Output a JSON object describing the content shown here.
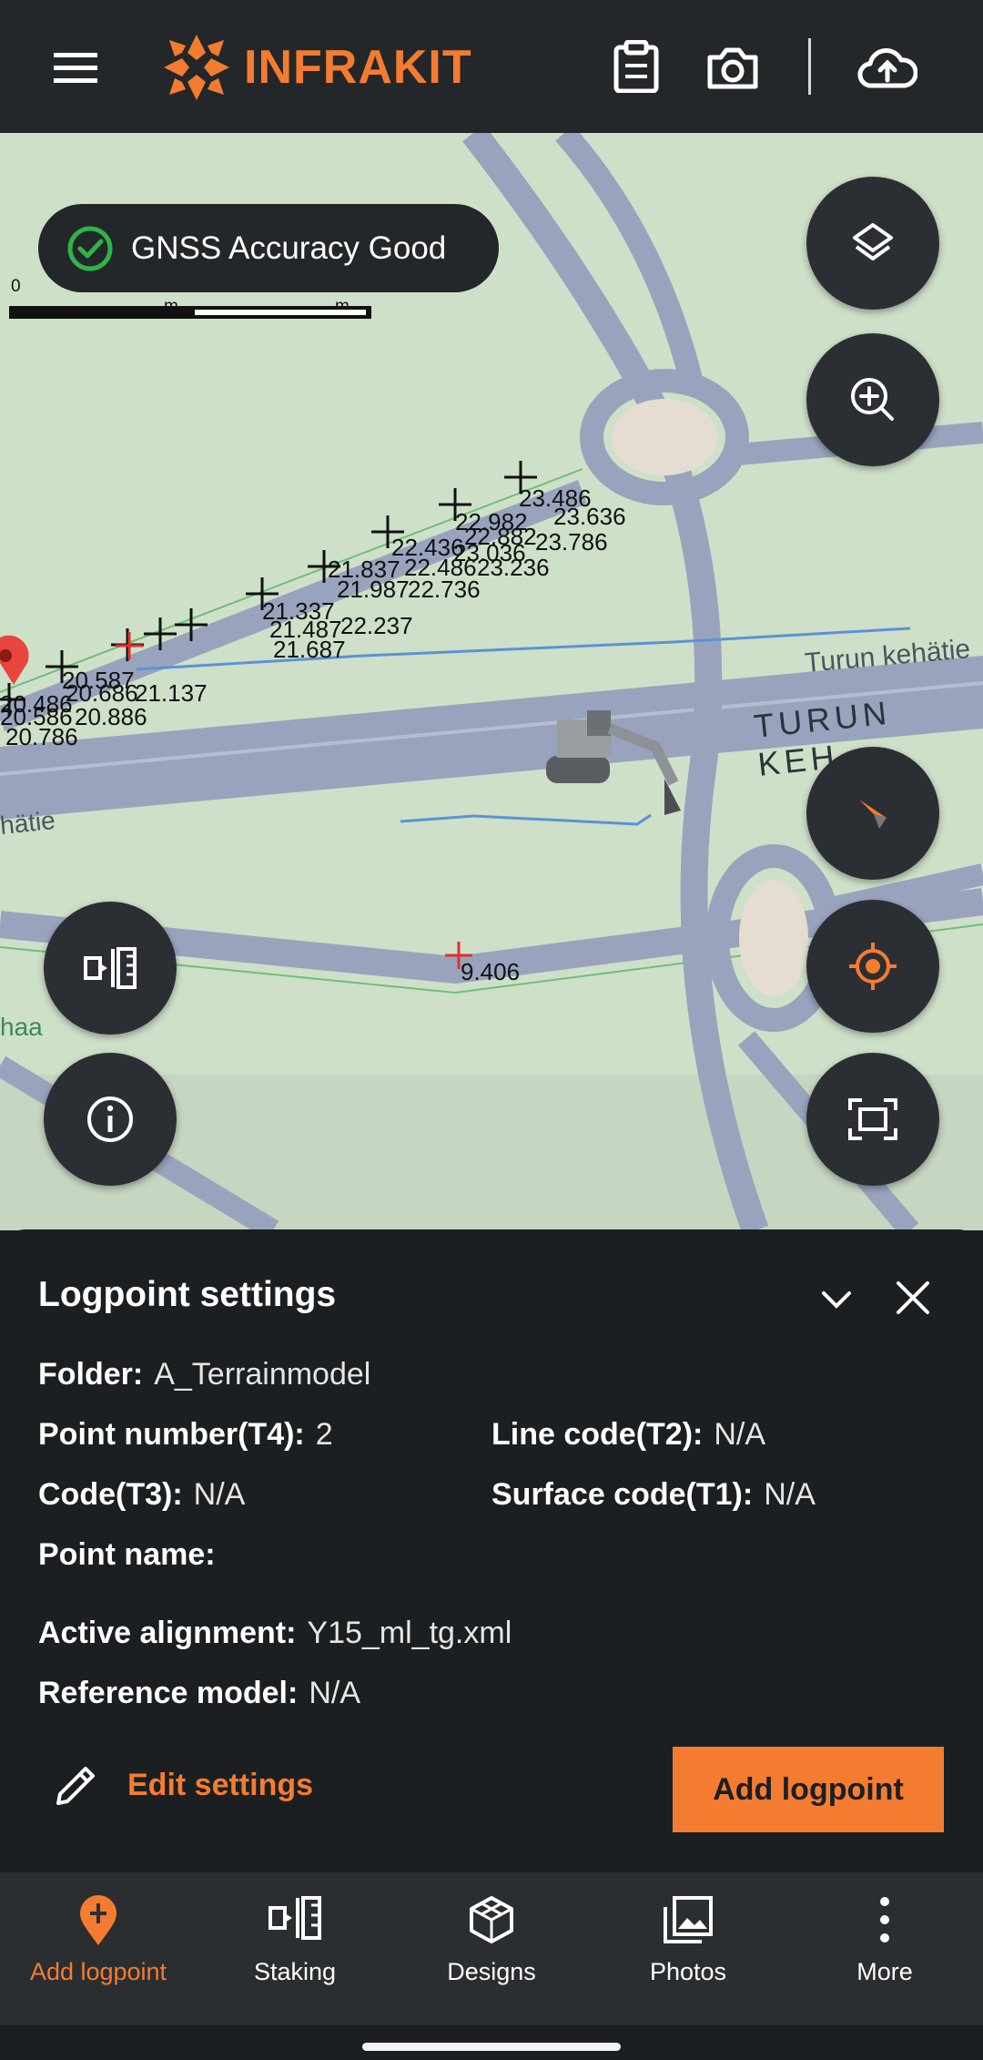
{
  "header": {
    "brand": "INFRAKIT",
    "icons": [
      "menu-icon",
      "clipboard-icon",
      "camera-icon",
      "cloud-upload-icon"
    ]
  },
  "map": {
    "scale": {
      "labels": [
        "0",
        "50 m",
        "100 m"
      ]
    },
    "gnss_status": "GNSS Accuracy Good",
    "street_labels": [
      "Turun kehätie",
      "TURUN KEH",
      "hätie",
      "haa"
    ],
    "point_values": [
      "23.486",
      "23.636",
      "22.982",
      "22.882",
      "23.786",
      "22.436",
      "23.036",
      "21.837",
      "22.486",
      "23.236",
      "21.987",
      "22.736",
      "21.337",
      "21.487",
      "22.237",
      "21.687",
      "20.587",
      "20.686",
      "21.137",
      "20.486",
      "20.586",
      "20.886",
      "20.786",
      "9.406"
    ],
    "fab_buttons": [
      "layers-icon",
      "zoom-in-icon",
      "compass-icon",
      "my-location-icon",
      "fit-screen-icon",
      "staking-icon",
      "info-icon"
    ]
  },
  "sheet": {
    "title": "Logpoint settings",
    "fields": {
      "folder": {
        "label": "Folder:",
        "value": "A_Terrainmodel"
      },
      "point_number": {
        "label": "Point number(T4):",
        "value": "2"
      },
      "line_code": {
        "label": "Line code(T2):",
        "value": "N/A"
      },
      "code": {
        "label": "Code(T3):",
        "value": "N/A"
      },
      "surface_code": {
        "label": "Surface code(T1):",
        "value": "N/A"
      },
      "point_name": {
        "label": "Point name:",
        "value": ""
      },
      "active_alignment": {
        "label": "Active alignment:",
        "value": "Y15_ml_tg.xml"
      },
      "reference_model": {
        "label": "Reference model:",
        "value": "N/A"
      }
    },
    "edit_label": "Edit settings",
    "add_label": "Add logpoint"
  },
  "nav": {
    "items": [
      {
        "label": "Add logpoint",
        "icon": "add-logpoint-icon",
        "active": true
      },
      {
        "label": "Staking",
        "icon": "staking-icon",
        "active": false
      },
      {
        "label": "Designs",
        "icon": "designs-icon",
        "active": false
      },
      {
        "label": "Photos",
        "icon": "photos-icon",
        "active": false
      },
      {
        "label": "More",
        "icon": "more-icon",
        "active": false
      }
    ]
  },
  "colors": {
    "accent": "#f47c30",
    "bar": "#23272a",
    "sheet": "#1b1f22",
    "good": "#2fb34a"
  }
}
